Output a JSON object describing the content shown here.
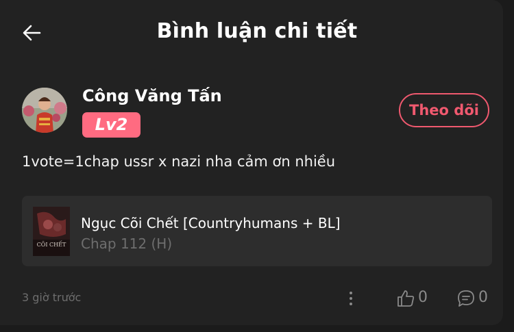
{
  "header": {
    "title": "Bình luận chi tiết",
    "back_icon": "arrow-left-icon"
  },
  "comment": {
    "username": "Công Văng Tấn",
    "level": "Lv2",
    "follow_label": "Theo dõi",
    "text": "1vote=1chap ussr x nazi nha cảm ơn nhiều",
    "time": "3 giờ trước",
    "likes": "0",
    "replies": "0"
  },
  "manga": {
    "title": "Ngục Cõi Chết [Countryhumans + BL]",
    "chapter": "Chap 112 (H)",
    "cover_text": "CÕI CHẾT"
  },
  "colors": {
    "accent": "#f0596f",
    "badge": "#ff6b81",
    "background": "#222222",
    "card": "#2d2d2d",
    "muted": "#6e6e6e"
  }
}
